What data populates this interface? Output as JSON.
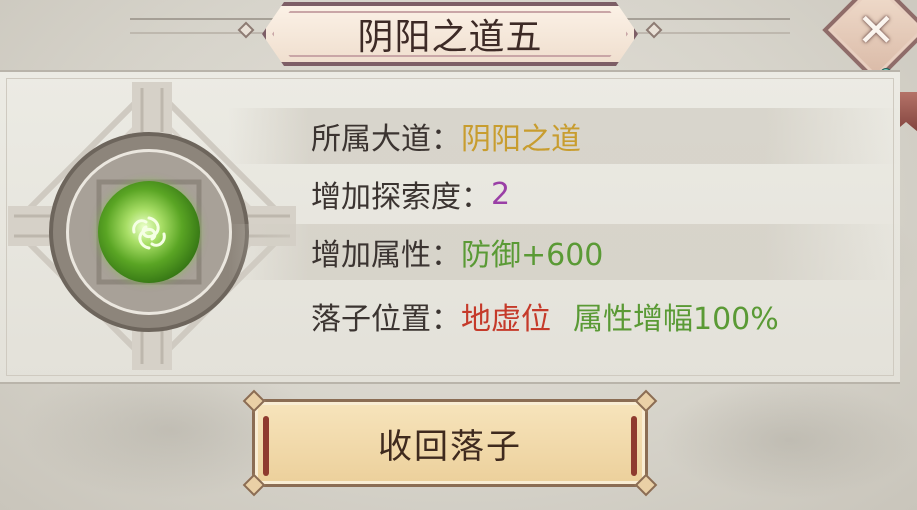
{
  "dialog": {
    "title": "阴阳之道五",
    "close_icon": "close-x-icon"
  },
  "emblem": {
    "icon": "yin-yang-orb-icon",
    "orb_color": "#5aa524"
  },
  "info": {
    "row1": {
      "label": "所属大道：",
      "value": "阴阳之道",
      "value_color": "#c89d2f"
    },
    "row2": {
      "label": "增加探索度：",
      "value": "2",
      "value_color": "#9a3fa6"
    },
    "row3": {
      "label": "增加属性：",
      "value": "防御+600",
      "value_color": "#5a9a35"
    },
    "row4": {
      "label": "落子位置：",
      "value": "地虚位",
      "value_color": "#c53a2a",
      "extra": "属性增幅100%",
      "extra_color": "#5a9a35"
    }
  },
  "actions": {
    "recall_label": "收回落子"
  }
}
